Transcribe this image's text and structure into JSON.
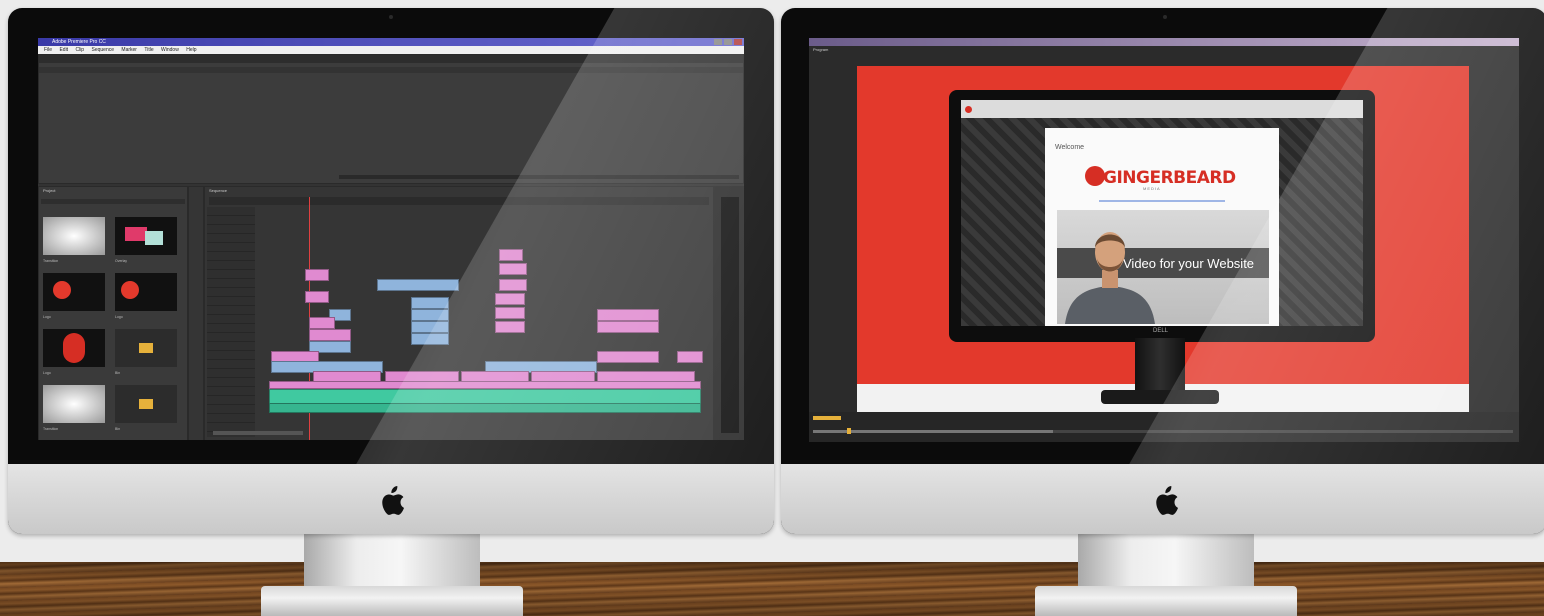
{
  "left_monitor": {
    "titlebar": {
      "text": "Adobe Premiere Pro CC"
    },
    "menu": [
      "File",
      "Edit",
      "Clip",
      "Sequence",
      "Marker",
      "Title",
      "Window",
      "Help"
    ],
    "project_panel": {
      "tab_label": "Project",
      "items": [
        {
          "label": "Transition",
          "kind": "gradient"
        },
        {
          "label": "Overlay",
          "kind": "graphic"
        },
        {
          "label": "Logo",
          "kind": "logo"
        },
        {
          "label": "Logo",
          "kind": "logo"
        },
        {
          "label": "Logo",
          "kind": "logo"
        },
        {
          "label": "Bin",
          "kind": "folder"
        },
        {
          "label": "Transition",
          "kind": "gradient"
        },
        {
          "label": "Bin",
          "kind": "folder"
        }
      ]
    },
    "timeline_panel": {
      "tab_label": "Sequence"
    }
  },
  "right_monitor": {
    "program_tab": "Program",
    "webpage": {
      "welcome": "Welcome",
      "logo_text": "GINGERBEARD",
      "logo_sub": "MEDIA",
      "video_caption": "Video for your Website"
    },
    "display_brand": "DELL"
  },
  "colors": {
    "accent_red": "#e3392c",
    "clip_pink": "#e08ad0",
    "clip_blue": "#8fb4dc",
    "audio_green": "#40c9a0"
  },
  "icons": {
    "apple_left": "apple-logo-icon",
    "apple_right": "apple-logo-icon"
  }
}
